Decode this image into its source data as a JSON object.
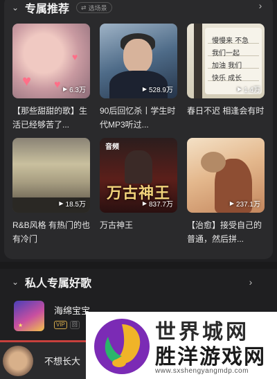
{
  "section1": {
    "title": "专属推荐",
    "pill_label": "选场景",
    "tiles": [
      {
        "plays": "6.3万",
        "caption": "【那些甜甜的歌】生活已经够苦了..."
      },
      {
        "plays": "528.9万",
        "caption": "90后回忆杀丨学生时代MP3听过..."
      },
      {
        "plays": "1.4万",
        "caption": "春日不迟 相逢会有时"
      },
      {
        "plays": "18.5万",
        "caption": "R&B风格 有热门的也有冷门"
      },
      {
        "plays": "837.7万",
        "caption": "万古神王",
        "badge": "音频",
        "art_title": "万古神王"
      },
      {
        "plays": "237.1万",
        "caption": "【治愈】接受自己的普通，然后拼..."
      }
    ],
    "note_text": [
      "慢慢来 不急",
      "我们一起",
      "加油 我们",
      "快乐 成长"
    ]
  },
  "section2": {
    "title": "私人专属好歌",
    "songs": [
      {
        "title": "海绵宝宝",
        "vip": "VIP",
        "chip": "回"
      }
    ]
  },
  "mini_player": {
    "title": "不想长大"
  },
  "watermark": {
    "line1": "世界城网",
    "line2": "胜洋游戏网",
    "url": "www.sxshengyangmdp.com"
  },
  "colors": {
    "accent": "#c8403d",
    "vip": "#d4a94a",
    "background": "#1f1f21"
  }
}
